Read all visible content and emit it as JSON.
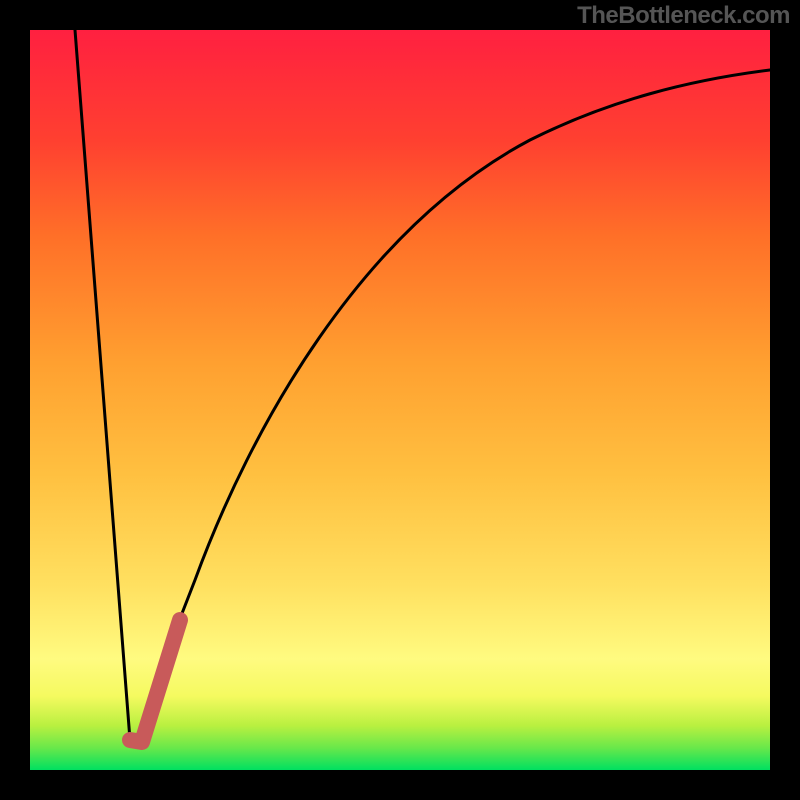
{
  "watermark": "TheBottleneck.com",
  "colors": {
    "frame": "#000000",
    "curve": "#000000",
    "highlight": "#c85a5a",
    "gradient_stops": [
      "#00e060",
      "#69e84a",
      "#b9f040",
      "#f5fa60",
      "#fffb80",
      "#ffe060",
      "#ffc040",
      "#ffa030",
      "#ff7028",
      "#ff4030",
      "#ff2040"
    ]
  },
  "chart_data": {
    "type": "line",
    "title": "",
    "xlabel": "",
    "ylabel": "",
    "xlim": [
      0,
      100
    ],
    "ylim": [
      0,
      100
    ],
    "grid": false,
    "legend": false,
    "series": [
      {
        "name": "bottleneck-curve",
        "x": [
          6,
          13.5,
          14.9,
          17.6,
          22.3,
          29.7,
          44.6,
          67.6,
          78.4,
          89.2,
          100
        ],
        "y": [
          100,
          4.1,
          4.1,
          13.5,
          25.7,
          45.9,
          73.0,
          85.1,
          90.5,
          93.2,
          94.6
        ]
      },
      {
        "name": "highlighted-range",
        "x": [
          13.5,
          15.1,
          20.3
        ],
        "y": [
          4.1,
          3.8,
          20.3
        ]
      }
    ],
    "annotations": [],
    "notes": "Background is a vertical spectral gradient (green at bottom through yellow/orange to red at top) inside a black frame. Values are normalized to 0–100 since no axes/ticks are shown."
  }
}
